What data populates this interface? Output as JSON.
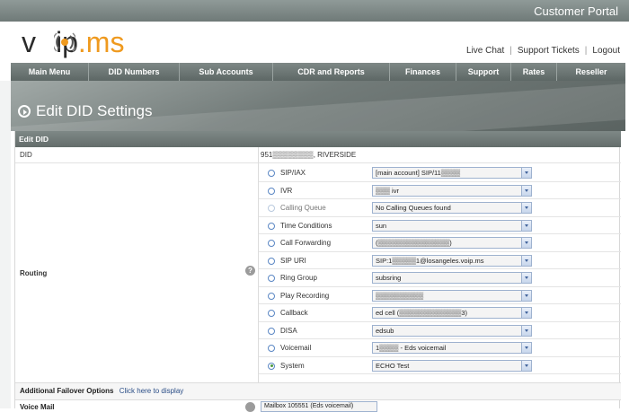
{
  "header": {
    "portal_title": "Customer Portal",
    "logo_left": "v",
    "logo_mid": "ip",
    "logo_dot": ".",
    "logo_ms": "ms",
    "links": [
      "Live Chat",
      "Support Tickets",
      "Logout"
    ]
  },
  "menu": [
    "Main Menu",
    "DID Numbers",
    "Sub Accounts",
    "CDR and Reports",
    "Finances",
    "Support",
    "Rates",
    "Reseller"
  ],
  "page": {
    "title": "Edit DID Settings"
  },
  "panel": {
    "heading": "Edit DID",
    "did_label": "DID",
    "did_value": "951▒▒▒▒▒▒▒▒, RIVERSIDE",
    "routing_label": "Routing",
    "help_glyph": "?"
  },
  "routing_options": [
    {
      "name": "SIP/IAX",
      "value": "[main account] SIP/11▒▒▒▒",
      "selected": false,
      "disabled": false
    },
    {
      "name": "IVR",
      "value": "▒▒▒ ivr",
      "selected": false,
      "disabled": false
    },
    {
      "name": "Calling Queue",
      "value": "No Calling Queues found",
      "selected": false,
      "disabled": true
    },
    {
      "name": "Time Conditions",
      "value": "sun",
      "selected": false,
      "disabled": false
    },
    {
      "name": "Call Forwarding",
      "value": "(▒▒▒▒▒▒▒▒▒▒▒▒▒▒▒)",
      "selected": false,
      "disabled": false
    },
    {
      "name": "SIP URI",
      "value": "SIP:1▒▒▒▒▒1@losangeles.voip.ms",
      "selected": false,
      "disabled": false
    },
    {
      "name": "Ring Group",
      "value": "subsring",
      "selected": false,
      "disabled": false
    },
    {
      "name": "Play Recording",
      "value": "▒▒▒▒▒▒▒▒▒▒",
      "selected": false,
      "disabled": false
    },
    {
      "name": "Callback",
      "value": "ed cell (▒▒▒▒▒▒▒▒▒▒▒▒▒3)",
      "selected": false,
      "disabled": false
    },
    {
      "name": "DISA",
      "value": "edsub",
      "selected": false,
      "disabled": false
    },
    {
      "name": "Voicemail",
      "value": "1▒▒▒▒ - Eds voicemail",
      "selected": false,
      "disabled": false
    },
    {
      "name": "System",
      "value": "ECHO Test",
      "selected": true,
      "disabled": false
    }
  ],
  "failover": {
    "label": "Additional Failover Options",
    "link": "Click here to display"
  },
  "voicemail_row": {
    "label": "Voice Mail",
    "value": "Mailbox 105551 (Eds voicemail)"
  }
}
